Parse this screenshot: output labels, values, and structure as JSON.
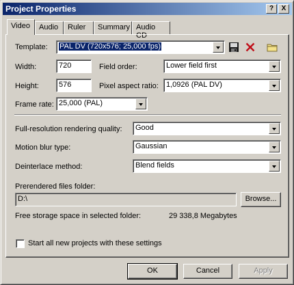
{
  "window": {
    "title": "Project Properties"
  },
  "title_buttons": {
    "help": "?",
    "close": "X"
  },
  "tabs": [
    {
      "label": "Video"
    },
    {
      "label": "Audio"
    },
    {
      "label": "Ruler"
    },
    {
      "label": "Summary"
    },
    {
      "label": "Audio CD"
    }
  ],
  "video": {
    "template_label": "Template:",
    "template_value": "PAL DV (720x576; 25,000 fps)",
    "width_label": "Width:",
    "width_value": "720",
    "height_label": "Height:",
    "height_value": "576",
    "field_order_label": "Field order:",
    "field_order_value": "Lower field first",
    "pixel_aspect_label": "Pixel aspect ratio:",
    "pixel_aspect_value": "1,0926 (PAL DV)",
    "frame_rate_label": "Frame rate:",
    "frame_rate_value": "25,000 (PAL)",
    "render_quality_label": "Full-resolution rendering quality:",
    "render_quality_value": "Good",
    "motion_blur_label": "Motion blur type:",
    "motion_blur_value": "Gaussian",
    "deinterlace_label": "Deinterlace method:",
    "deinterlace_value": "Blend fields",
    "prerendered_label": "Prerendered files folder:",
    "prerendered_value": "D:\\",
    "browse_label": "Browse...",
    "free_space_label": "Free storage space in selected folder:",
    "free_space_value": "29 338,8 Megabytes",
    "start_all_label": "Start all new projects with these settings"
  },
  "footer": {
    "ok": "OK",
    "cancel": "Cancel",
    "apply": "Apply"
  },
  "icons": [
    "save-icon",
    "delete-icon",
    "folder-icon"
  ]
}
